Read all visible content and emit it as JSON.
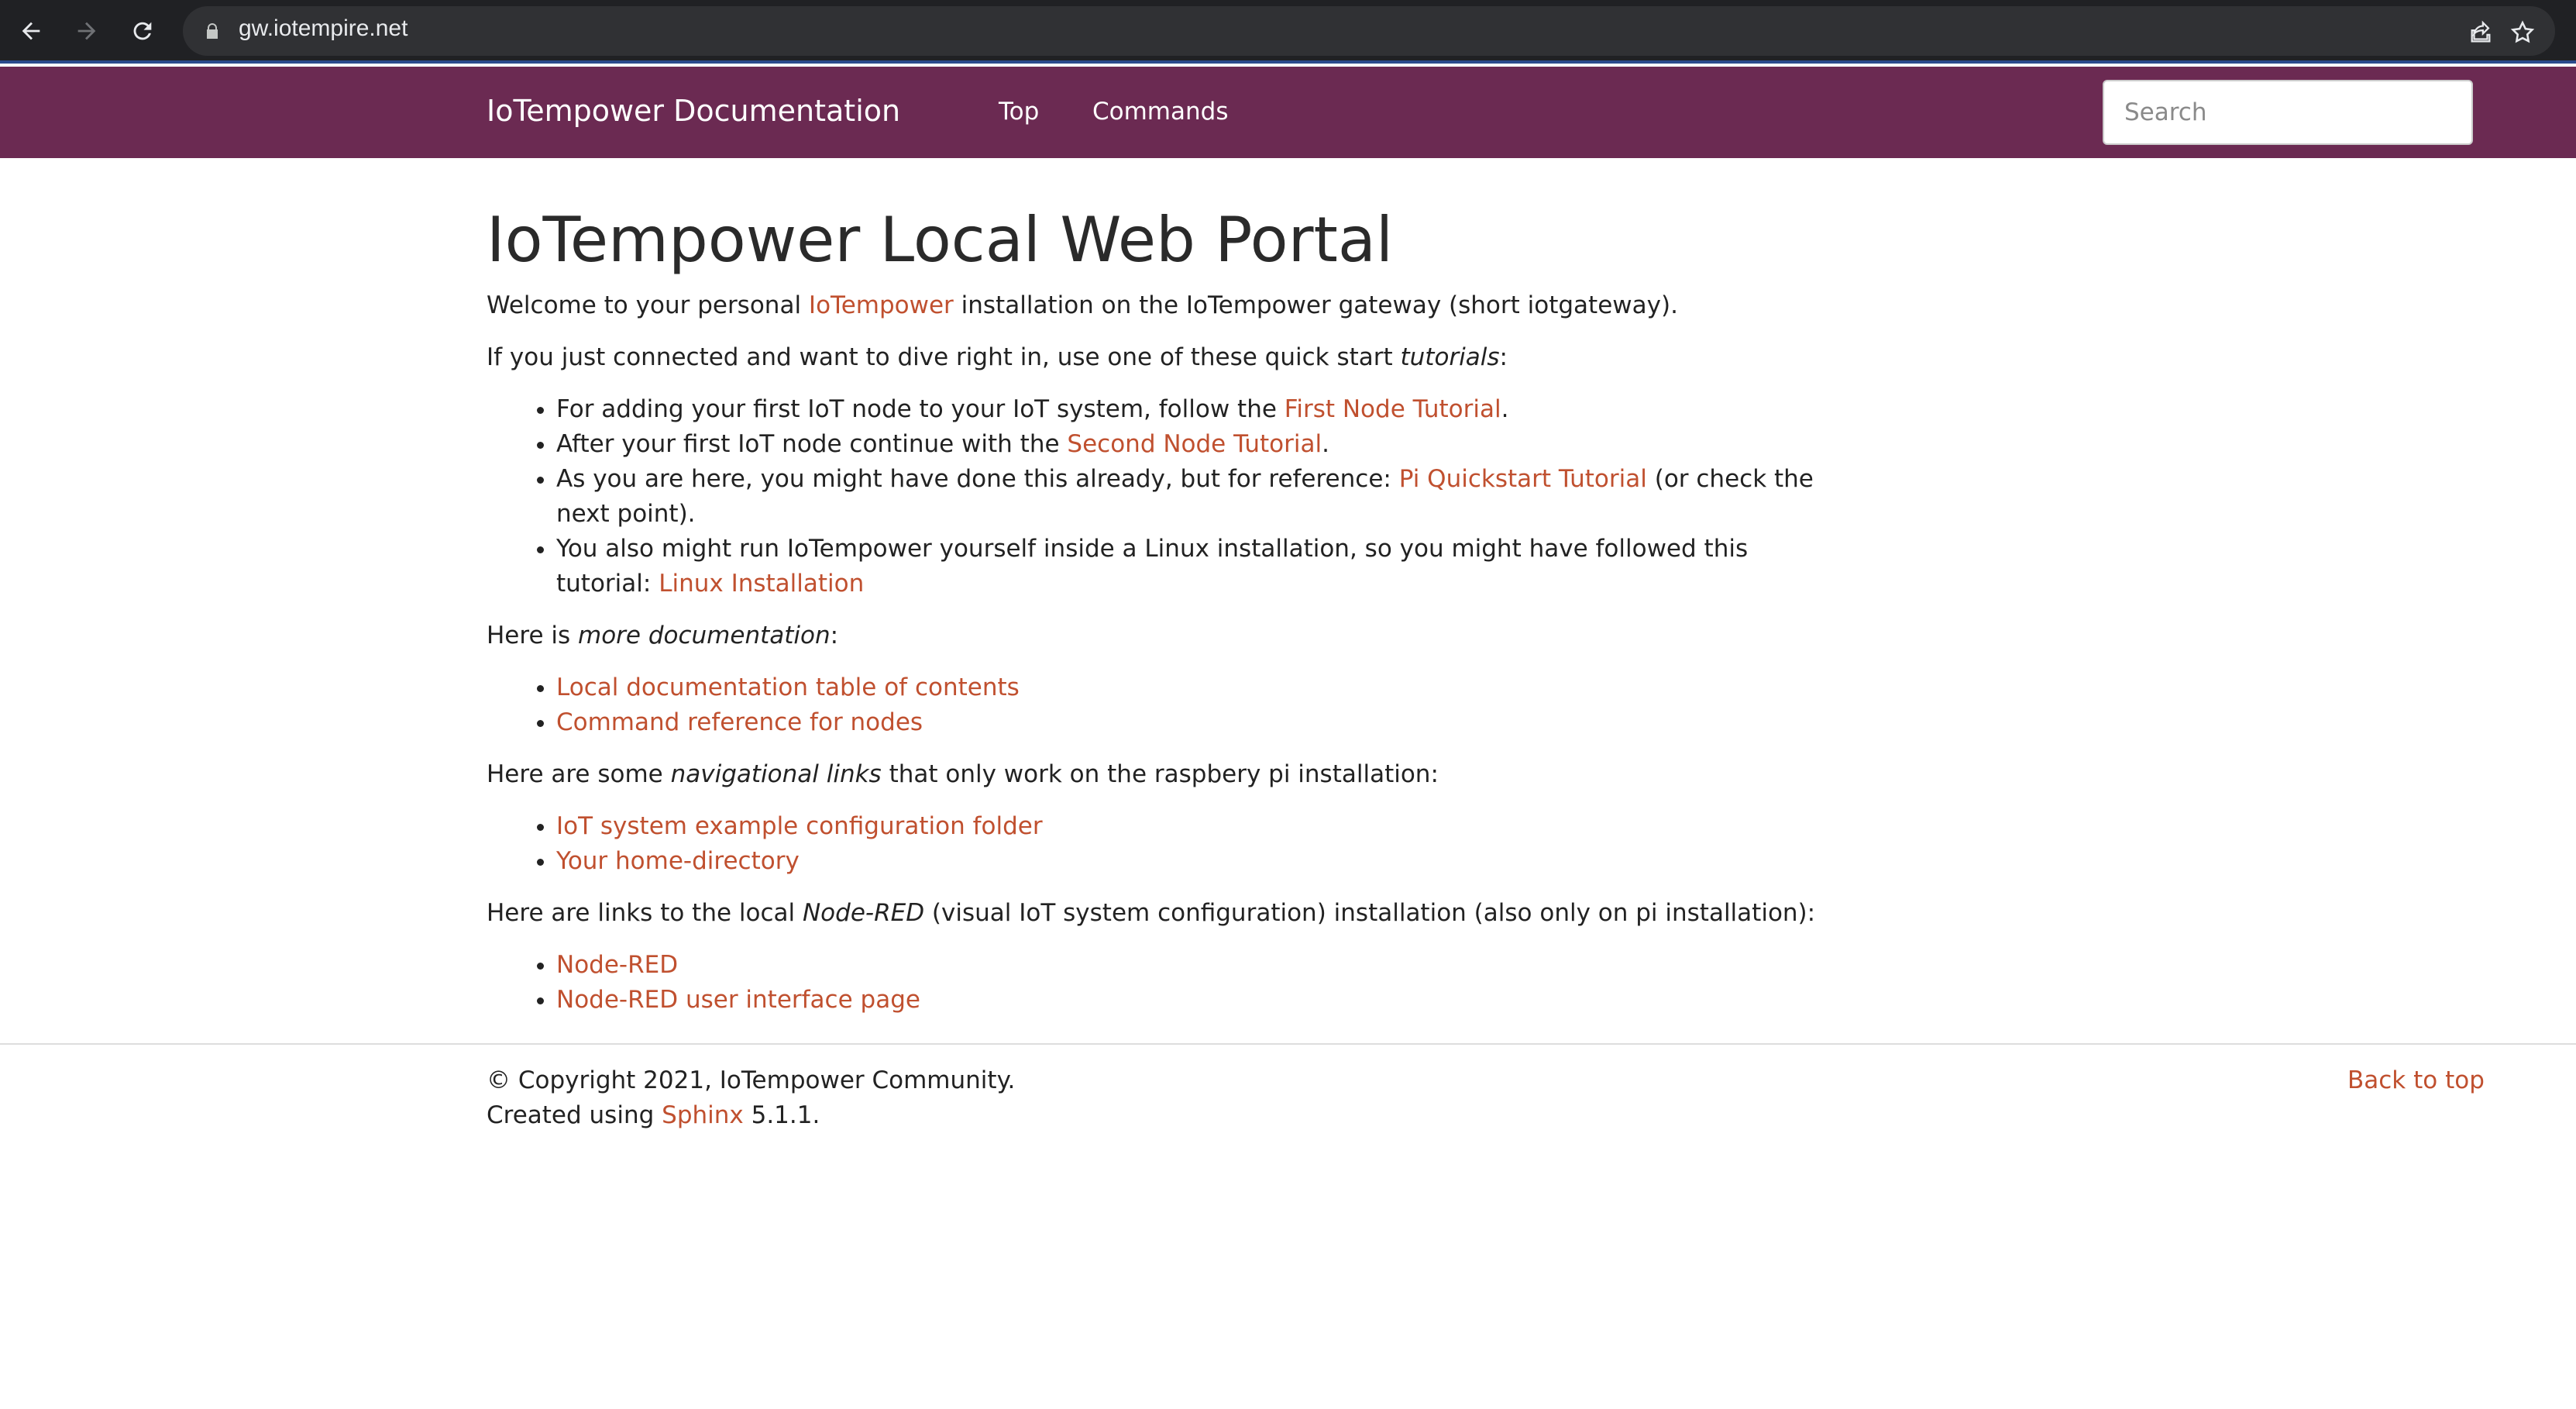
{
  "browser": {
    "url": "gw.iotempire.net",
    "icons": [
      "back-arrow-icon",
      "forward-arrow-icon",
      "reload-icon",
      "lock-icon",
      "share-icon",
      "bookmark-star-icon"
    ]
  },
  "navbar": {
    "brand": "IoTempower Documentation",
    "links": [
      "Top",
      "Commands"
    ],
    "search_placeholder": "Search",
    "color": "#6b2a52"
  },
  "main": {
    "title": "IoTempower Local Web Portal",
    "intro": {
      "before": "Welcome to your personal ",
      "link": "IoTempower",
      "after": " installation on the IoTempower gateway (short iotgateway)."
    },
    "quickstart": {
      "before": "If you just connected and want to dive right in, use one of these quick start ",
      "em": "tutorials",
      "after": ":"
    },
    "tutorial_items": [
      {
        "before": "For adding your first IoT node to your IoT system, follow the ",
        "link": "First Node Tutorial",
        "after": "."
      },
      {
        "before": "After your first IoT node continue with the ",
        "link": "Second Node Tutorial",
        "after": "."
      },
      {
        "before": "As you are here, you might have done this already, but for reference: ",
        "link": "Pi Quickstart Tutorial",
        "after": " (or check the next point)."
      },
      {
        "before": "You also might run IoTempower yourself inside a Linux installation, so you might have followed this tutorial: ",
        "link": "Linux Installation",
        "after": ""
      }
    ],
    "more_docs": {
      "before": "Here is ",
      "em": "more documentation",
      "after": ":"
    },
    "doc_links": [
      "Local documentation table of contents",
      "Command reference for nodes"
    ],
    "nav_links_intro": {
      "before": "Here are some ",
      "em": "navigational links",
      "after": " that only work on the raspbery pi installation:"
    },
    "nav_links": [
      "IoT system example configuration folder",
      "Your home-directory"
    ],
    "nodered_intro": {
      "before": "Here are links to the local ",
      "em": "Node-RED",
      "after": " (visual IoT system configuration) installation (also only on pi installation):"
    },
    "nodered_links": [
      "Node-RED",
      "Node-RED user interface page"
    ]
  },
  "footer": {
    "copyright": "© Copyright 2021, IoTempower Community.",
    "created_before": "Created using ",
    "created_link": "Sphinx",
    "created_after": " 5.1.1.",
    "back_to_top": "Back to top"
  },
  "colors": {
    "link": "#c0502f",
    "navbar": "#6b2a52",
    "chrome": "#202124"
  }
}
